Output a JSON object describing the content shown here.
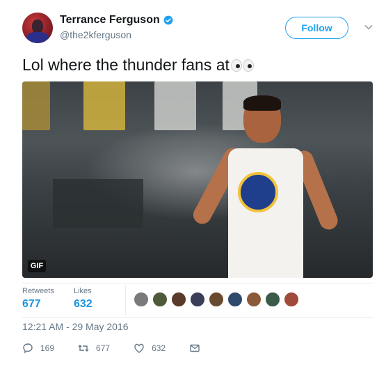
{
  "author": {
    "name": "Terrance Ferguson",
    "handle": "@the2kferguson"
  },
  "follow_label": "Follow",
  "tweet": {
    "text": "Lol where the thunder fans at"
  },
  "media": {
    "badge": "GIF"
  },
  "stats": {
    "retweets_label": "Retweets",
    "retweets_value": "677",
    "likes_label": "Likes",
    "likes_value": "632"
  },
  "timestamp": "12:21 AM - 29 May 2016",
  "actions": {
    "reply_count": "169",
    "retweet_count": "677",
    "like_count": "632"
  },
  "colors": {
    "accent": "#1da1f2",
    "link": "#1b95e0",
    "muted": "#657786"
  },
  "icons": [
    "verified-badge-icon",
    "chevron-down-icon",
    "reply-icon",
    "retweet-icon",
    "heart-icon",
    "message-icon"
  ]
}
